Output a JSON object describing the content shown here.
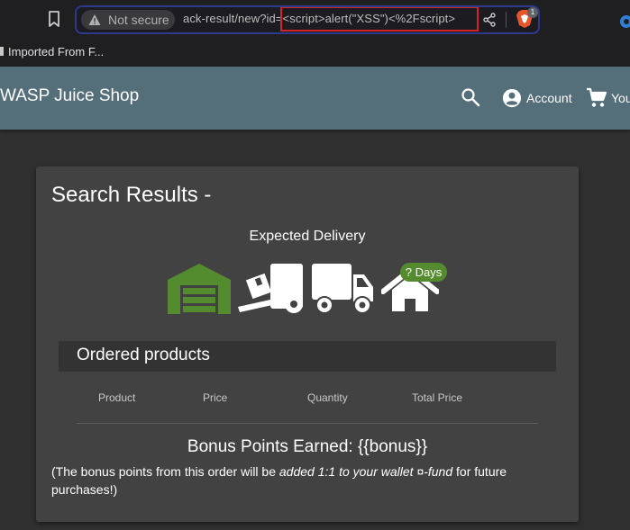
{
  "browser": {
    "security_label": "Not secure",
    "url_prefix": "ack-result/new?id",
    "url_payload": "=<script>alert(\"XSS\")<%2Fscript>",
    "extension_badge": "1",
    "bookmark_item": "Imported From F..."
  },
  "toolbar": {
    "title": "WASP Juice Shop",
    "account_label": "Account",
    "basket_label": "You"
  },
  "card": {
    "title": "Search Results -",
    "delivery_label": "Expected Delivery",
    "days_badge": "? Days",
    "products_title": "Ordered products",
    "columns": [
      "Product",
      "Price",
      "Quantity",
      "Total Price"
    ],
    "bonus_title": "Bonus Points Earned: {{bonus}}",
    "bonus_note_start": "(The bonus points from this order will be ",
    "bonus_note_em": "added 1:1 to your wallet ¤-fund",
    "bonus_note_end": " for future purchases!)"
  },
  "colors": {
    "toolbar": "#546e7a",
    "background": "#303030",
    "card": "#424242",
    "delivery_green": "#558b2f",
    "url_highlight": "#d32525"
  },
  "icons": [
    "bookmark-icon",
    "warning-icon",
    "share-icon",
    "brave-shield-icon",
    "search-icon",
    "account-circle-icon",
    "shopping-cart-icon",
    "warehouse-icon",
    "dolly-icon",
    "truck-icon",
    "home-icon"
  ]
}
